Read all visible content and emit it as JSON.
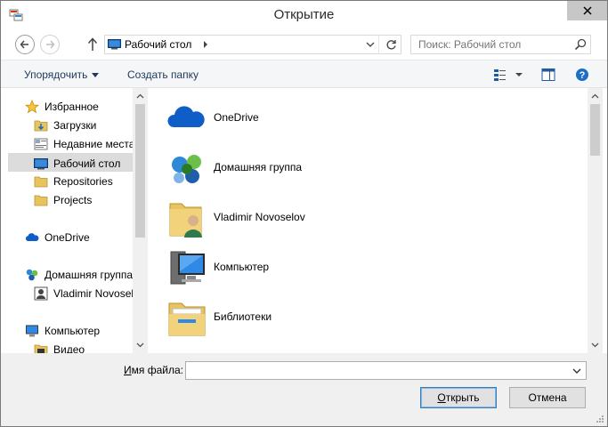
{
  "window": {
    "title": "Открытие",
    "close_icon": "close-icon"
  },
  "navbar": {
    "back_icon": "back-arrow-icon",
    "forward_icon": "forward-arrow-icon",
    "up_icon": "up-arrow-icon",
    "address_location": "Рабочий стол",
    "refresh_icon": "refresh-icon",
    "search_placeholder": "Поиск: Рабочий стол"
  },
  "toolbar": {
    "arrange_label": "Упорядочить",
    "new_folder_label": "Создать папку",
    "view_icon": "view-options-icon",
    "preview_pane_icon": "preview-pane-icon",
    "help_icon": "help-icon"
  },
  "nav_pane": {
    "items": [
      {
        "label": "Избранное",
        "icon": "star-icon"
      },
      {
        "label": "Загрузки",
        "icon": "downloads-folder-icon"
      },
      {
        "label": "Недавние места",
        "icon": "recent-places-icon"
      },
      {
        "label": "Рабочий стол",
        "icon": "desktop-icon",
        "selected": true
      },
      {
        "label": "Repositories",
        "icon": "folder-icon"
      },
      {
        "label": "Projects",
        "icon": "folder-icon"
      },
      {
        "label": "OneDrive",
        "icon": "onedrive-icon"
      },
      {
        "label": "Домашняя группа",
        "icon": "homegroup-icon"
      },
      {
        "label": "Vladimir Novoselov",
        "icon": "user-icon"
      },
      {
        "label": "Компьютер",
        "icon": "computer-icon"
      },
      {
        "label": "Видео",
        "icon": "video-folder-icon"
      }
    ]
  },
  "content": {
    "items": [
      {
        "label": "OneDrive",
        "icon": "onedrive-icon"
      },
      {
        "label": "Домашняя группа",
        "icon": "homegroup-icon"
      },
      {
        "label": "Vladimir Novoselov",
        "icon": "user-folder-icon"
      },
      {
        "label": "Компьютер",
        "icon": "computer-icon"
      },
      {
        "label": "Библиотеки",
        "icon": "libraries-icon"
      }
    ]
  },
  "bottom": {
    "filename_label_accel": "И",
    "filename_label_rest": "мя файла:",
    "filename_value": "",
    "open_accel": "О",
    "open_rest": "ткрыть",
    "cancel_label": "Отмена"
  },
  "colors": {
    "accent": "#1e395b",
    "selection": "#dcdcdc",
    "onedrive_blue": "#0f5ec7"
  }
}
